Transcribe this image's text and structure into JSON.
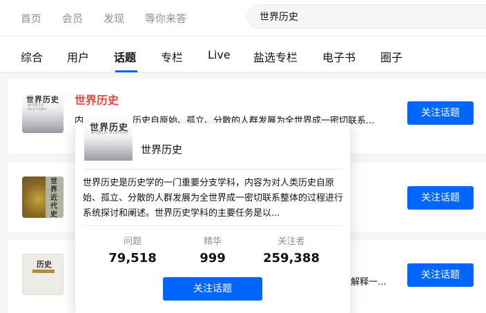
{
  "topnav": {
    "links": [
      "首页",
      "会员",
      "发现",
      "等你来答"
    ],
    "search_value": "世界历史"
  },
  "tabs": {
    "items": [
      "综合",
      "用户",
      "话题",
      "专栏",
      "Live",
      "盐选专栏",
      "电子书",
      "圈子"
    ],
    "active": "话题"
  },
  "results": [
    {
      "title": "世界历史",
      "description_prefix": "内",
      "description": "历史自原始、孤立、分散的人群发展为全世界成一密切联系...",
      "cover_title": "世界历史",
      "cover_subtitle": "WORLD HISTORY",
      "follow_label": "关注话题"
    },
    {
      "cover_title": "世界近代史",
      "follow_label": "关注话题"
    },
    {
      "description_tail": "解释一...",
      "cover_title": "历史",
      "follow_label": "关注话题"
    }
  ],
  "popover": {
    "title": "世界历史",
    "cover_title": "世界历史",
    "cover_subtitle": "WORLD HISTORY",
    "description": "世界历史是历史学的一门重要分支学科，内容为对人类历史自原始、孤立、分散的人群发展为全世界成一密切联系整体的过程进行系统探讨和阐述。世界历史学科的主要任务是以...",
    "stats": [
      {
        "label": "问题",
        "value": "79,518"
      },
      {
        "label": "精华",
        "value": "999"
      },
      {
        "label": "关注者",
        "value": "259,388"
      }
    ],
    "follow_label": "关注话题"
  },
  "colors": {
    "accent": "#0066ff",
    "title_highlight": "#f1403c",
    "muted": "#8590a6"
  }
}
